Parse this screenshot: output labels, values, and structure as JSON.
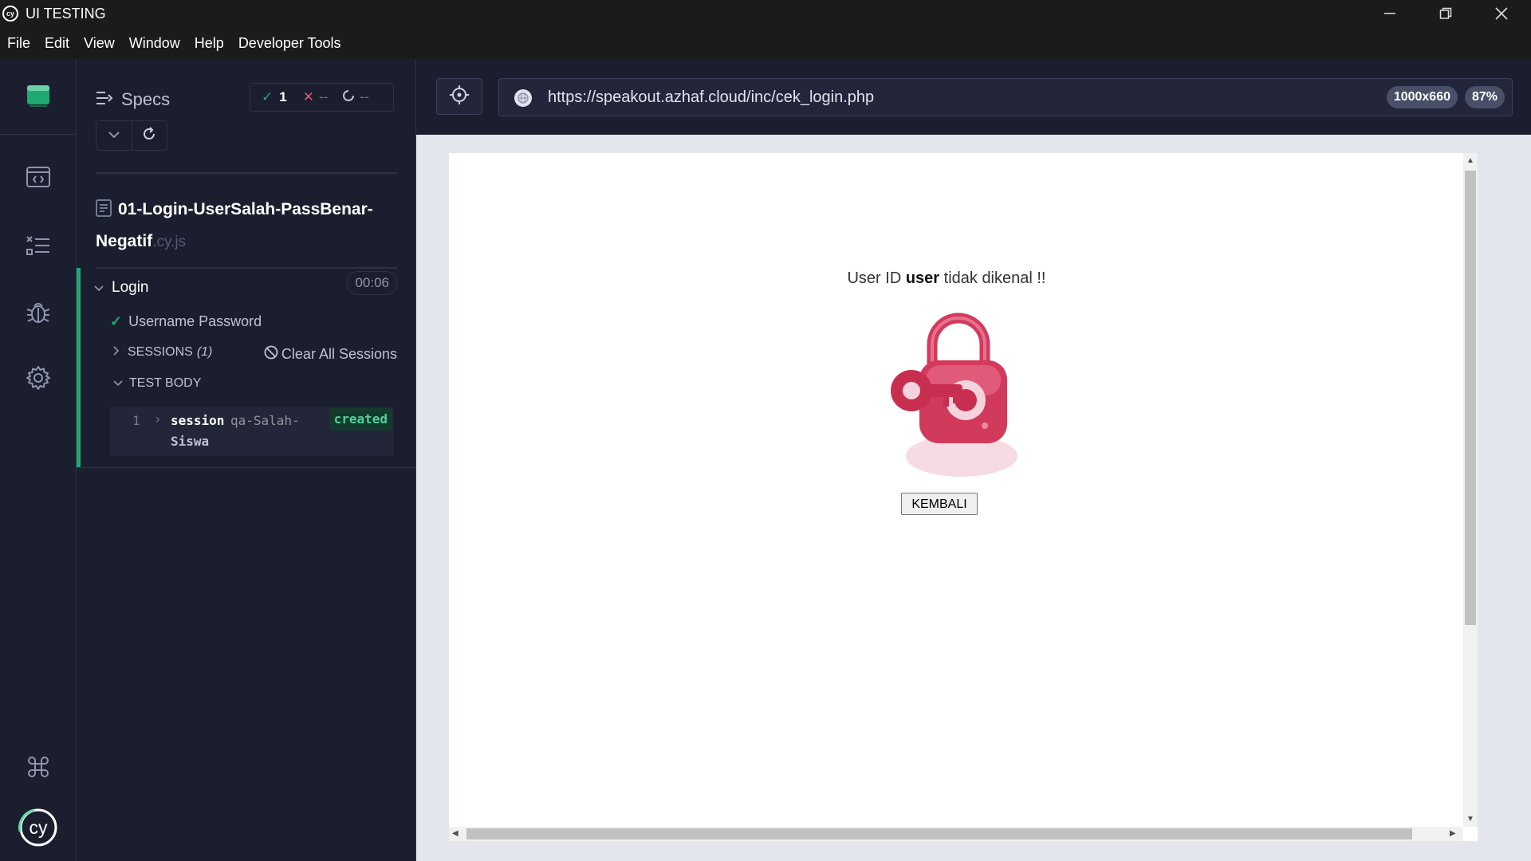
{
  "window": {
    "title": "UI TESTING",
    "controls": [
      "minimize",
      "restore",
      "close"
    ]
  },
  "menu": [
    "File",
    "Edit",
    "View",
    "Window",
    "Help",
    "Developer Tools"
  ],
  "rail": {
    "icons": [
      "specs-list-icon",
      "runs-icon",
      "test-list-icon",
      "debug-bug-icon",
      "settings-gear-icon",
      "keyboard-shortcuts-icon",
      "cypress-logo-icon"
    ],
    "logo_text": "cy"
  },
  "specs_panel": {
    "title": "Specs",
    "stats": {
      "passed": "1",
      "failed": "--",
      "pending": "--"
    },
    "spec": {
      "name": "01-Login-UserSalah-PassBenar-Negatif",
      "ext": ".cy.js",
      "duration": "00:06"
    },
    "suite": "Login",
    "test": "Username Password",
    "sessions": {
      "label": "SESSIONS",
      "count": "(1)",
      "clear_label": "Clear All Sessions"
    },
    "test_body_label": "TEST BODY",
    "command": {
      "number": "1",
      "name": "session",
      "message": "qa-Salah-",
      "message_cont": "Siswa",
      "badge": "created"
    }
  },
  "aut": {
    "url": "https://speakout.azhaf.cloud/inc/cek_login.php",
    "viewport_size": "1000x660",
    "zoom": "87%",
    "page": {
      "message_pre": "User ID ",
      "message_user": "user",
      "message_post": " tidak dikenal !!",
      "button_label": "KEMBALI"
    }
  },
  "colors": {
    "pass": "#1fa971",
    "fail": "#e45770",
    "accent_lock": "#d23a5c",
    "background": "#1b1e2e"
  }
}
